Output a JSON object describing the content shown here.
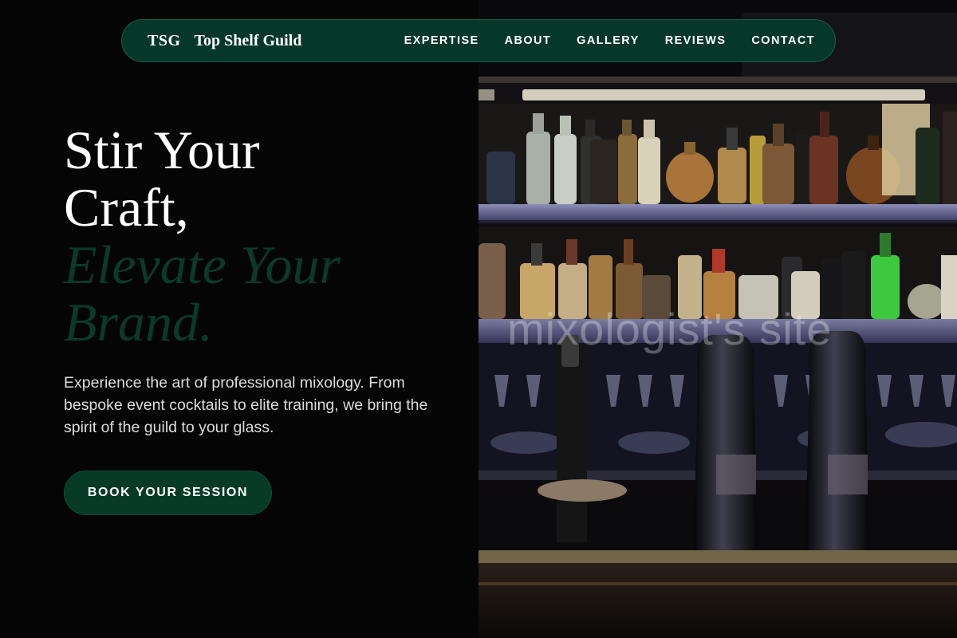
{
  "nav": {
    "abbr": "TSG",
    "brand_name": "Top Shelf Guild",
    "links": [
      "EXPERTISE",
      "ABOUT",
      "GALLERY",
      "REVIEWS",
      "CONTACT"
    ]
  },
  "hero": {
    "headline_line1": "Stir Your",
    "headline_line2": "Craft,",
    "headline_line3": "Elevate Your",
    "headline_line4": "Brand.",
    "lede": "Experience the art of professional mixology. From bespoke event cocktails to elite training, we bring the spirit of the guild to your glass.",
    "cta_label": "BOOK YOUR SESSION"
  },
  "photo": {
    "watermark": "mixologist's site",
    "subject": "back bar with liquor bottles and beer taps"
  },
  "colors": {
    "accent_green": "#073a27",
    "accent_text_green": "#0a3a28",
    "background": "#050505"
  }
}
